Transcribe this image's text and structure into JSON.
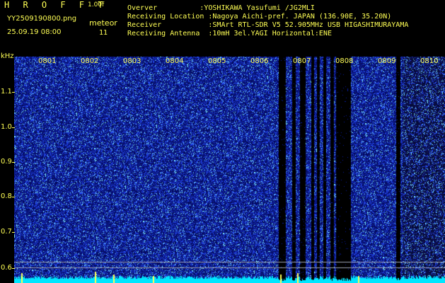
{
  "header": {
    "app_title": "H R O F F T",
    "version": "1.00f",
    "filename": "YY2509190800.png",
    "datetime": "25.09.19 08:00",
    "meteor_label": "meteor",
    "meteor_count": "11",
    "meta": [
      "Overver          :YOSHIKAWA Yasufumi /JG2MLI",
      "Receiving Location :Nagoya Aichi-pref. JAPAN (136.90E, 35.20N)",
      "Receiver           :SMArt RTL-SDR V5 52.905MHz USB HIGASHIMURAYAMA",
      "Receiving Antenna  :10mH 3el.YAGI Horizontal:ENE"
    ]
  },
  "plot": {
    "y_unit": "kHz",
    "y_ticks": [
      "1.1",
      "1.0",
      "0.9",
      "0.8",
      "0.7",
      "0.6"
    ],
    "x_ticks": [
      "0801",
      "0802",
      "0803",
      "0804",
      "0805",
      "0806",
      "0807",
      "0808",
      "0809",
      "0810"
    ],
    "colors": {
      "background": "#000000",
      "noise_dark": "#0a1a8a",
      "noise_mid": "#2244ff",
      "noise_bright": "#7fe8ff",
      "baseline": "#00e6ff",
      "label": "#ffff55"
    }
  }
}
